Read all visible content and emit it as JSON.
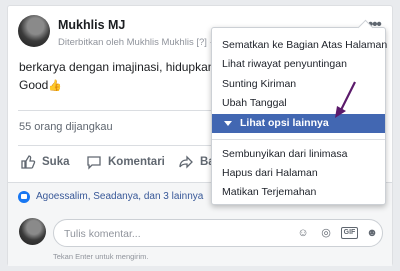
{
  "post": {
    "author": "Mukhlis MJ",
    "meta": "Diterbitkan oleh Mukhlis Mukhlis [?] ·",
    "text_line1": "berkarya dengan imajinasi, hidupkan ki",
    "text_line2": "Good",
    "emoji": "👍",
    "reach": "55 orang dijangkau"
  },
  "actions": {
    "like": "Suka",
    "comment": "Komentari",
    "share": "Ba"
  },
  "likes_summary": "Agoessalim, Seadanya, dan 3 lainnya",
  "comment": {
    "placeholder": "Tulis komentar...",
    "hint": "Tekan Enter untuk mengirim.",
    "gif_label": "GIF"
  },
  "menu": {
    "items_top": [
      "Sematkan ke Bagian Atas Halaman",
      "Lihat riwayat penyuntingan",
      "Sunting Kiriman",
      "Ubah Tanggal"
    ],
    "selected": "Lihat opsi lainnya",
    "items_bottom": [
      "Sembunyikan dari linimasa",
      "Hapus dari Halaman",
      "Matikan Terjemahan"
    ]
  },
  "colors": {
    "accent": "#4267b2",
    "link": "#385898",
    "annotation_arrow": "#5b1a6b"
  }
}
